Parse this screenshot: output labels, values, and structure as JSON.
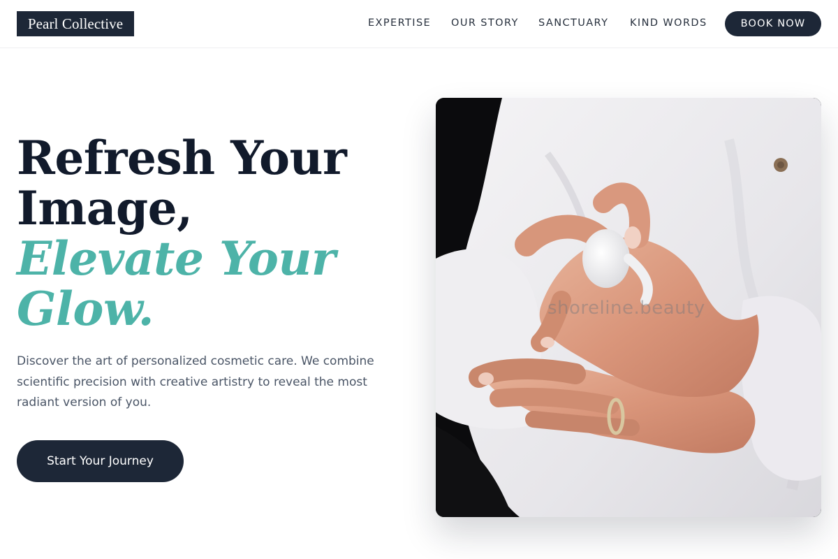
{
  "brand": {
    "name": "Pearl Collective"
  },
  "nav": {
    "items": [
      {
        "label": "EXPERTISE"
      },
      {
        "label": "OUR STORY"
      },
      {
        "label": "SANCTUARY"
      },
      {
        "label": "KIND WORDS"
      }
    ],
    "cta_label": "BOOK NOW"
  },
  "hero": {
    "headline_line1": "Refresh Your",
    "headline_line2": "Image,",
    "headline_accent_line1": "Elevate Your",
    "headline_accent_line2": "Glow.",
    "description": "Discover the art of personalized cosmetic care. We combine scientific precision with creative artistry to reveal the most radiant version of you.",
    "cta_label": "Start Your Journey",
    "image_watermark": "shoreline.beauty"
  },
  "colors": {
    "navy": "#1d2737",
    "accent_teal": "#4db3a8",
    "body_text": "#4a5566",
    "background": "#ffffff"
  }
}
